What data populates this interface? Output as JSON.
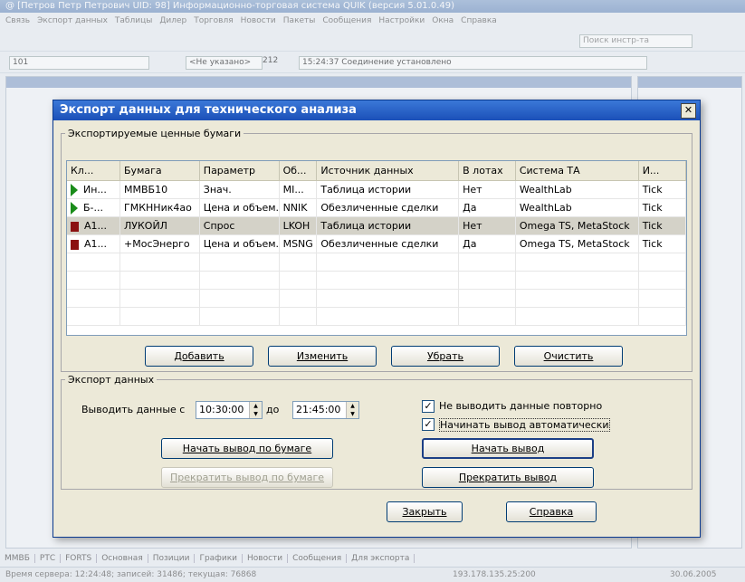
{
  "app": {
    "title": "@ [Петров Петр Петрович UID: 98] Информационно-торговая система QUIK (версия 5.01.0.49)",
    "menu": [
      "Связь",
      "Экспорт данных",
      "Таблицы",
      "Дилер",
      "Торговля",
      "Новости",
      "Пакеты",
      "Сообщения",
      "Настройки",
      "Окна",
      "Справка"
    ],
    "toolbar_account": "101",
    "toolbar_dropdown": "<Не указано>",
    "toolbar_count": "212",
    "toolbar_status": "15:24:37 Соединение установлено",
    "search_placeholder": "Поиск инстр-та",
    "bottom_tabs": [
      "ММВБ",
      "РТС",
      "FORTS",
      "Основная",
      "Позиции",
      "Графики",
      "Новости",
      "Сообщения",
      "Для экспорта"
    ],
    "status": {
      "server_time": "Время сервера: 12:24:48; записей: 31486; текущая: 76868",
      "ip": "193.178.135.25:200",
      "date": "30.06.2005"
    }
  },
  "dialog": {
    "title": "Экспорт данных для технического анализа",
    "group_securities": "Экспортируемые ценные бумаги",
    "columns": [
      "Кл...",
      "Бумага",
      "Параметр",
      "Об...",
      "Источник данных",
      "В лотах",
      "Система ТА",
      "И..."
    ],
    "rows": [
      {
        "marker": "green",
        "class": "Ин...",
        "security": "ММВБ10",
        "param": "Знач.",
        "obj": "MI...",
        "source": "Таблица истории",
        "lots": "Нет",
        "system": "WealthLab",
        "interval": "Tick",
        "selected": false
      },
      {
        "marker": "green",
        "class": "Б-...",
        "security": "ГМКННик4ао",
        "param": "Цена и объем...",
        "obj": "NNIK",
        "source": "Обезличенные сделки",
        "lots": "Да",
        "system": "WealthLab",
        "interval": "Tick",
        "selected": false
      },
      {
        "marker": "red",
        "class": "А1...",
        "security": "ЛУКОЙЛ",
        "param": "Спрос",
        "obj": "LKOH",
        "source": "Таблица истории",
        "lots": "Нет",
        "system": "Omega TS, MetaStock",
        "interval": "Tick",
        "selected": true
      },
      {
        "marker": "red",
        "class": "А1...",
        "security": "+МосЭнерго",
        "param": "Цена и объем...",
        "obj": "MSNG",
        "source": "Обезличенные сделки",
        "lots": "Да",
        "system": "Omega TS, MetaStock",
        "interval": "Tick",
        "selected": false
      }
    ],
    "buttons_table": {
      "add": "Добавить",
      "edit": "Изменить",
      "remove": "Убрать",
      "clear": "Очистить"
    },
    "group_export": "Экспорт данных",
    "output_label": "Выводить данные с",
    "time_from": "10:30:00",
    "to_label": "до",
    "time_to": "21:45:00",
    "no_repeat": "Не выводить данные повторно",
    "auto_start": "Начинать вывод автоматически",
    "buttons_export": {
      "start_sec": "Начать вывод по бумаге",
      "stop_sec": "Прекратить вывод по бумаге",
      "start": "Начать вывод",
      "stop": "Прекратить вывод"
    },
    "close": "Закрыть",
    "help": "Справка"
  },
  "colors": {
    "marker_green": "#1a8c1a",
    "marker_red": "#8b1111",
    "titlebar": "#1b50b8"
  }
}
